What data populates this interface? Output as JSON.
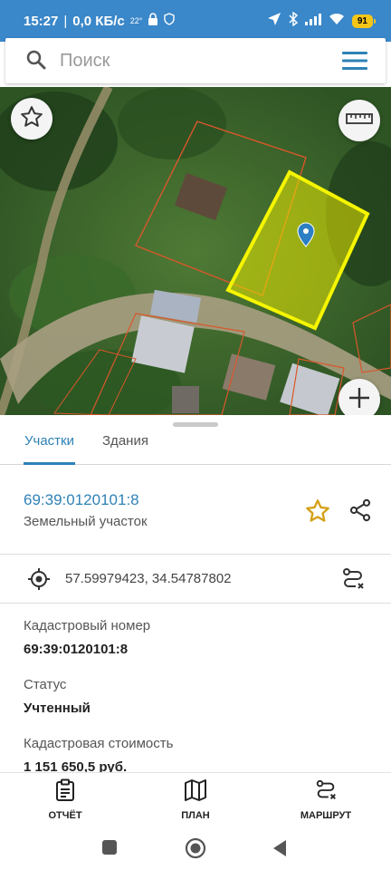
{
  "status_bar": {
    "time": "15:27",
    "speed": "0,0 КБ/с",
    "temp_sup": "22°",
    "battery": "91"
  },
  "search": {
    "placeholder": "Поиск"
  },
  "tabs": [
    {
      "label": "Участки",
      "active": true
    },
    {
      "label": "Здания",
      "active": false
    }
  ],
  "parcel": {
    "id": "69:39:0120101:8",
    "type": "Земельный участок",
    "favorite_color": "#d4a017"
  },
  "coordinates": "57.59979423, 34.54787802",
  "fields": [
    {
      "label": "Кадастровый номер",
      "value": "69:39:0120101:8"
    },
    {
      "label": "Статус",
      "value": "Учтенный"
    },
    {
      "label": "Кадастровая стоимость",
      "value": "1 151 650,5 руб."
    }
  ],
  "bottom_nav": [
    {
      "label": "ОТЧЁТ",
      "icon": "report-icon"
    },
    {
      "label": "ПЛАН",
      "icon": "map-icon"
    },
    {
      "label": "МАРШРУТ",
      "icon": "route-icon"
    }
  ],
  "colors": {
    "accent": "#2e82b7",
    "status_bar": "#3a87c9",
    "parcel_highlight": "#f0f000"
  }
}
